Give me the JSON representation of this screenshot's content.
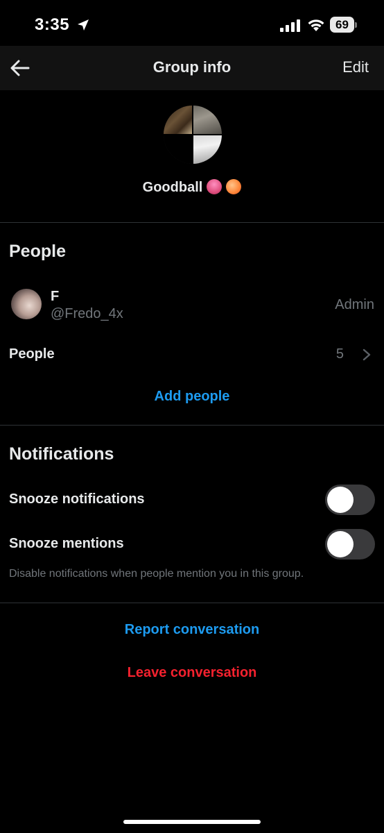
{
  "status_bar": {
    "time": "3:35",
    "battery_level": "69",
    "icons": [
      "location-arrow-icon",
      "signal-icon",
      "wifi-icon",
      "battery-icon"
    ]
  },
  "nav": {
    "title": "Group info",
    "edit_label": "Edit",
    "back_icon": "arrow-left-icon"
  },
  "group": {
    "name": "Goodball",
    "emojis": [
      "tongue-emoji",
      "peach-emoji"
    ]
  },
  "people_section": {
    "heading": "People",
    "admin": {
      "name": "F",
      "handle": "@Fredo_4x",
      "role": "Admin"
    },
    "people_label": "People",
    "people_count": "5",
    "add_people_label": "Add people"
  },
  "notifications_section": {
    "heading": "Notifications",
    "snooze_notifications_label": "Snooze notifications",
    "snooze_notifications_on": false,
    "snooze_mentions_label": "Snooze mentions",
    "snooze_mentions_on": false,
    "helper_text": "Disable notifications when people mention you in this group."
  },
  "actions": {
    "report_label": "Report conversation",
    "leave_label": "Leave conversation"
  },
  "colors": {
    "background": "#000000",
    "accent_blue": "#1d9bf0",
    "danger_red": "#f4212e",
    "secondary_text": "#71767b"
  }
}
